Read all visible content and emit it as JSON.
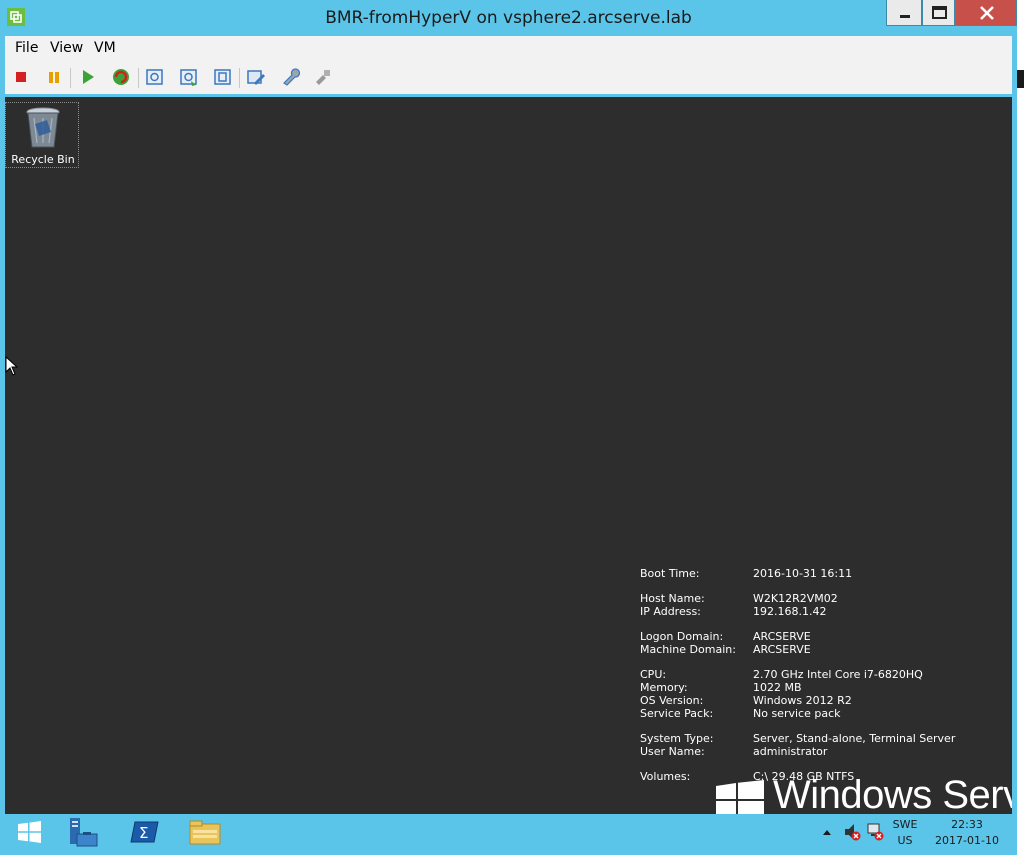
{
  "window": {
    "title": "BMR-fromHyperV on vsphere2.arcserve.lab",
    "minimize_icon": "minimize-icon",
    "maximize_icon": "maximize-icon",
    "close_icon": "close-icon",
    "accent": "#5bc5e9"
  },
  "menu": {
    "items": [
      "File",
      "View",
      "VM"
    ]
  },
  "toolbar": {
    "icons": [
      "stop-icon",
      "pause-icon",
      "play-icon",
      "reset-icon",
      "snapshot-icon",
      "revert-snapshot-icon",
      "snapshot-manager-icon",
      "edit-settings-icon",
      "tools-icon",
      "connect-device-icon"
    ]
  },
  "desktop": {
    "recycle_bin_label": "Recycle Bin",
    "background": "#2d2d2d"
  },
  "bginfo": {
    "rows": [
      {
        "label": "Boot Time:",
        "value": "2016-10-31 16:11"
      },
      {
        "label": "Host Name:",
        "value": "W2K12R2VM02"
      },
      {
        "label": "IP Address:",
        "value": "192.168.1.42"
      },
      {
        "label": "Logon Domain:",
        "value": "ARCSERVE"
      },
      {
        "label": "Machine Domain:",
        "value": "ARCSERVE"
      },
      {
        "label": "CPU:",
        "value": "2.70 GHz Intel Core i7-6820HQ"
      },
      {
        "label": "Memory:",
        "value": "1022 MB"
      },
      {
        "label": "OS Version:",
        "value": "Windows 2012 R2"
      },
      {
        "label": "Service Pack:",
        "value": "No service pack"
      },
      {
        "label": "System Type:",
        "value": "Server, Stand-alone, Terminal Server"
      },
      {
        "label": "User Name:",
        "value": "administrator"
      },
      {
        "label": "Volumes:",
        "value": "C:\\ 29.48 GB NTFS"
      }
    ]
  },
  "branding": {
    "text": "Windows Serve"
  },
  "taskbar": {
    "items": [
      "start-icon",
      "server-manager-icon",
      "powershell-icon",
      "file-explorer-icon"
    ],
    "tray": {
      "lang_top": "SWE",
      "lang_bottom": "US",
      "time": "22:33",
      "date": "2017-01-10"
    }
  }
}
